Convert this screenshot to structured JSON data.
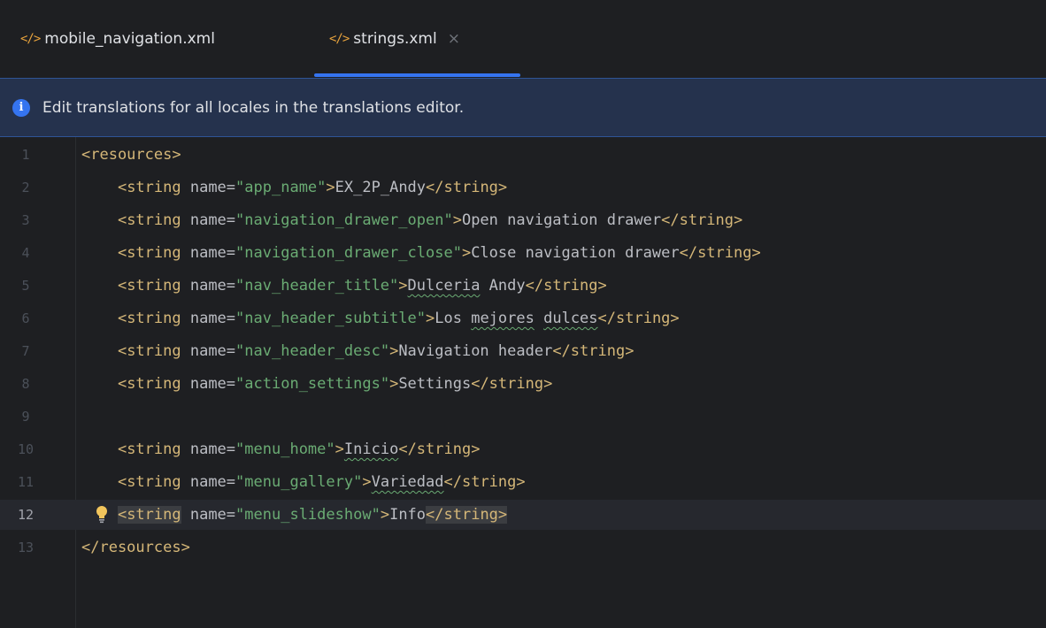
{
  "tabs": [
    {
      "label": "mobile_navigation.xml",
      "icon": "xml-file-icon"
    },
    {
      "label": "strings.xml",
      "icon": "xml-file-icon",
      "active": true,
      "close": "×"
    }
  ],
  "banner": {
    "text": "Edit translations for all locales in the translations editor.",
    "icon": "info-icon"
  },
  "editor": {
    "current_line": 12,
    "line_numbers": [
      "1",
      "2",
      "3",
      "4",
      "5",
      "6",
      "7",
      "8",
      "9",
      "10",
      "11",
      "12",
      "13"
    ],
    "lines": [
      {
        "tag_open": "<resources>"
      },
      {
        "name": "app_name",
        "value": "EX_2P_Andy"
      },
      {
        "name": "navigation_drawer_open",
        "value": "Open navigation drawer"
      },
      {
        "name": "navigation_drawer_close",
        "value": "Close navigation drawer"
      },
      {
        "name": "nav_header_title",
        "value_a": "Dulceria",
        "value_b": " Andy"
      },
      {
        "name": "nav_header_subtitle",
        "value_a": "Los ",
        "value_b": "mejores",
        "value_c": " ",
        "value_d": "dulces"
      },
      {
        "name": "nav_header_desc",
        "value": "Navigation header"
      },
      {
        "name": "action_settings",
        "value": "Settings"
      },
      {},
      {
        "name": "menu_home",
        "value": "Inicio"
      },
      {
        "name": "menu_gallery",
        "value": "Variedad"
      },
      {
        "name": "menu_slideshow",
        "value": "Info"
      },
      {
        "tag_close": "</resources>"
      }
    ],
    "syntax": {
      "string_open": "<string",
      "attr_name": " name=",
      "tag_end": ">",
      "string_close": "</string>"
    }
  },
  "colors": {
    "background": "#1e1f22",
    "accent": "#3574f0",
    "tag": "#d5b778",
    "value": "#6aab73",
    "banner": "#25324d"
  }
}
